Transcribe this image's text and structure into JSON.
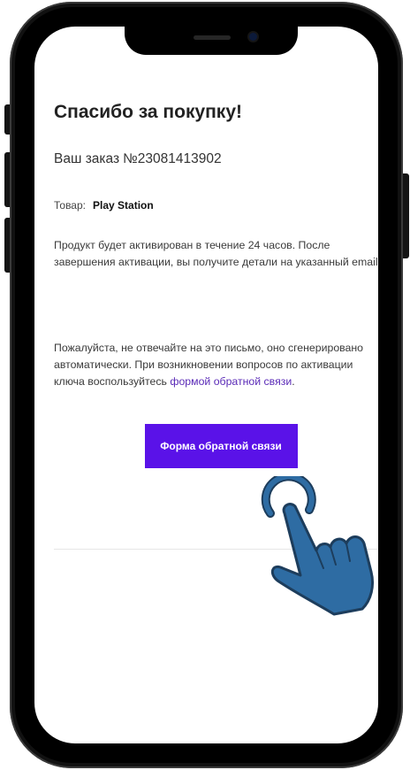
{
  "email": {
    "title": "Спасибо за покупку!",
    "order_label": "Ваш заказ",
    "order_number": "№23081413902",
    "product_label": "Товар:",
    "product_name": "Play Station",
    "activation_text": "Продукт будет активирован в течение 24 часов. После завершения активации, вы получите детали на указанный email.",
    "notice_text": "Пожалуйста, не отвечайте на это письмо, оно сгенерировано автоматически. При возникновении вопросов по активации ключа воспользуйтесь",
    "notice_link": "формой обратной связи",
    "notice_end": ".",
    "feedback_button_label": "Форма обратной связи"
  },
  "colors": {
    "button": "#5a12e8",
    "link": "#5a2ab7",
    "hand": "#2e6ca3",
    "hand_outline": "#1d3d5c"
  },
  "icons": {
    "pointer": "tap-hand-icon"
  }
}
